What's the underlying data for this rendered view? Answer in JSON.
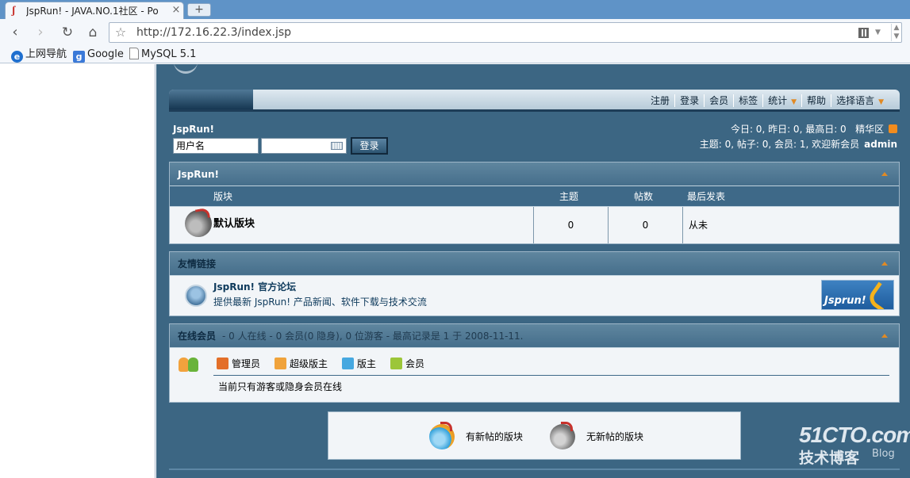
{
  "browser": {
    "tab_title": "JspRun! - JAVA.NO.1社区 - Po",
    "tab_close": "×",
    "new_tab": "+",
    "url": "http://172.16.22.3/index.jsp",
    "bookmarks": [
      {
        "label": "上网导航"
      },
      {
        "label": "Google"
      },
      {
        "label": "MySQL 5.1"
      }
    ]
  },
  "nav": {
    "items": [
      {
        "label": "注册"
      },
      {
        "label": "登录"
      },
      {
        "label": "会员"
      },
      {
        "label": "标签"
      },
      {
        "label": "统计"
      },
      {
        "label": "帮助"
      },
      {
        "label": "选择语言"
      }
    ]
  },
  "login": {
    "brand": "JspRun!",
    "username_value": "用户名",
    "submit_label": "登录"
  },
  "stats": {
    "line1": "今日: 0, 昨日: 0, 最高日: 0",
    "digest_link": "精华区",
    "line2": "主题: 0, 帖子: 0, 会员: 1, 欢迎新会员",
    "newest_member": "admin"
  },
  "forum_panel": {
    "title": "JspRun!",
    "columns": [
      "版块",
      "主题",
      "帖数",
      "最后发表"
    ],
    "rows": [
      {
        "name": "默认版块",
        "threads": "0",
        "posts": "0",
        "last_post": "从未"
      }
    ]
  },
  "links_panel": {
    "title": "友情链接",
    "links": [
      {
        "name": "JspRun! 官方论坛",
        "description": "提供最新 JspRun! 产品新闻、软件下载与技术交流",
        "logo_text": "Jsprun!"
      }
    ]
  },
  "online_panel": {
    "title": "在线会员",
    "info": "- 0 人在线 - 0 会员(0 隐身), 0 位游客 - 最高记录是 1 于 2008-11-11.",
    "legend": [
      {
        "label": "管理员",
        "color": "#e36f29"
      },
      {
        "label": "超级版主",
        "color": "#f0a33b"
      },
      {
        "label": "版主",
        "color": "#46a8e0"
      },
      {
        "label": "会员",
        "color": "#9cc639"
      }
    ],
    "note": "当前只有游客或隐身会员在线"
  },
  "icon_legend": {
    "new_label": "有新帖的版块",
    "old_label": "无新帖的版块"
  },
  "watermark": {
    "domain": "51CTO.com",
    "tagline": "技术博客",
    "blog": "Blog"
  },
  "colors": {
    "page_bg": "#3c6683",
    "panel_head": "#456e8b",
    "accent_orange": "#e18a24"
  }
}
